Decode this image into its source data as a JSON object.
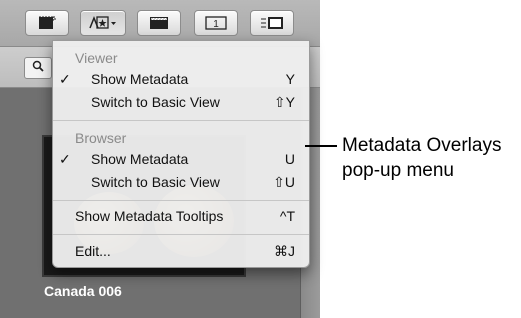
{
  "toolbar": {
    "buttons": [
      {
        "icon": "viewer-display-icon"
      },
      {
        "icon": "metadata-overlays-icon"
      },
      {
        "icon": "filmstrip-icon"
      },
      {
        "icon": "single-view-icon"
      },
      {
        "icon": "list-view-icon"
      }
    ]
  },
  "browser": {
    "thumbnail_caption": "Canada 006"
  },
  "menu": {
    "viewer_header": "Viewer",
    "viewer_show_metadata": {
      "check": "✓",
      "label": "Show Metadata",
      "shortcut": "Y"
    },
    "viewer_basic_view": {
      "label": "Switch to Basic View",
      "shortcut": "⇧Y"
    },
    "browser_header": "Browser",
    "browser_show_metadata": {
      "check": "✓",
      "label": "Show Metadata",
      "shortcut": "U"
    },
    "browser_basic_view": {
      "label": "Switch to Basic View",
      "shortcut": "⇧U"
    },
    "tooltips": {
      "label": "Show Metadata Tooltips",
      "shortcut": "^T"
    },
    "edit": {
      "label": "Edit...",
      "shortcut": "⌘J"
    }
  },
  "callout": {
    "line1": "Metadata Overlays",
    "line2": "pop-up menu"
  }
}
